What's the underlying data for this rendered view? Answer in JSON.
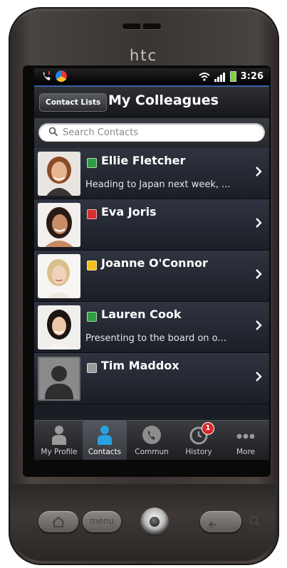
{
  "device": {
    "brand": "htc",
    "hw_menu_label": "menu"
  },
  "statusbar": {
    "time": "3:26"
  },
  "header": {
    "back_label": "Contact Lists",
    "title": "My Colleagues"
  },
  "search": {
    "placeholder": "Search Contacts"
  },
  "contacts": [
    {
      "name": "Ellie Fletcher",
      "presence": "available",
      "presence_color": "#2e9e45",
      "status": "Heading to Japan next week, ..."
    },
    {
      "name": "Eva Joris",
      "presence": "busy",
      "presence_color": "#d43030",
      "status": ""
    },
    {
      "name": "Joanne O'Connor",
      "presence": "away",
      "presence_color": "#f0c020",
      "status": ""
    },
    {
      "name": "Lauren Cook",
      "presence": "available",
      "presence_color": "#2e9e45",
      "status": "Presenting to the board on o..."
    },
    {
      "name": "Tim Maddox",
      "presence": "offline",
      "presence_color": "#9a9a9a",
      "status": ""
    }
  ],
  "tabs": [
    {
      "label": "My Profile",
      "icon": "person-icon"
    },
    {
      "label": "Contacts",
      "icon": "contacts-icon",
      "active": true
    },
    {
      "label": "Commun",
      "icon": "phone-icon"
    },
    {
      "label": "History",
      "icon": "clock-icon",
      "badge": "1"
    },
    {
      "label": "More",
      "icon": "more-icon"
    }
  ],
  "colors": {
    "accent": "#3a63a8",
    "tab_active_icon": "#2aa0e0"
  }
}
